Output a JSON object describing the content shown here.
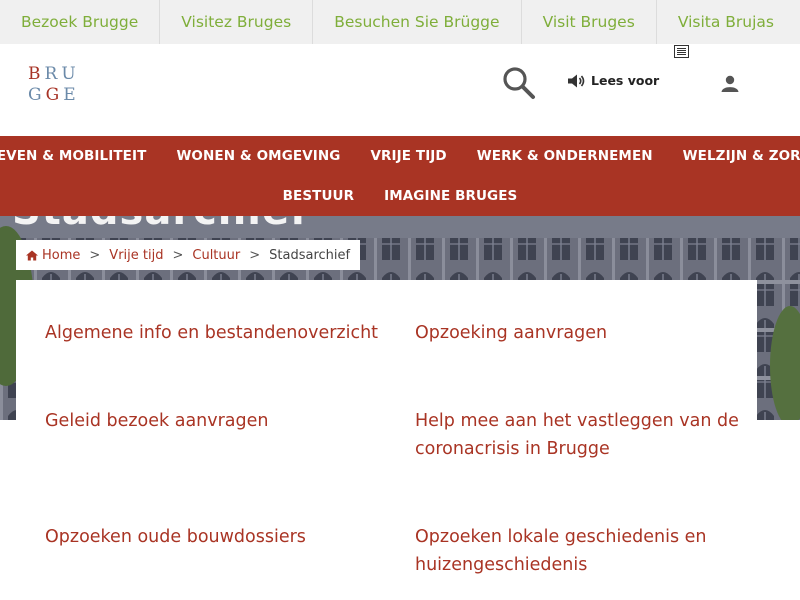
{
  "languages": [
    "Bezoek Brugge",
    "Visitez Bruges",
    "Besuchen Sie Brügge",
    "Visit Bruges",
    "Visita Brujas"
  ],
  "logo": {
    "row1": [
      "B",
      "R",
      "U"
    ],
    "row2": [
      "G",
      "G",
      "E"
    ]
  },
  "header": {
    "read_aloud_label": "Lees voor"
  },
  "nav": {
    "row1": [
      "LEVEN & MOBILITEIT",
      "WONEN & OMGEVING",
      "VRIJE TIJD",
      "WERK & ONDERNEMEN",
      "WELZIJN & ZORG"
    ],
    "row2": [
      "BESTUUR",
      "IMAGINE BRUGES"
    ]
  },
  "hero": {
    "title": "Stadsarchief"
  },
  "breadcrumb": {
    "home": "Home",
    "crumb1": "Vrije tijd",
    "crumb2": "Cultuur",
    "current": "Stadsarchief",
    "separator": ">"
  },
  "links": {
    "l1": "Algemene info en bestandenoverzicht",
    "l2": "Opzoeking aanvragen",
    "l3": "Geleid bezoek aanvragen",
    "l4": "Help mee aan het vastleggen van de coronacrisis in Brugge",
    "l5": "Opzoeken oude bouwdossiers",
    "l6": "Opzoeken lokale geschiedenis en huizengeschiedenis"
  },
  "colors": {
    "accent": "#a93424",
    "lang_link": "#7fae3a",
    "logo_blue": "#6b8aa9"
  }
}
